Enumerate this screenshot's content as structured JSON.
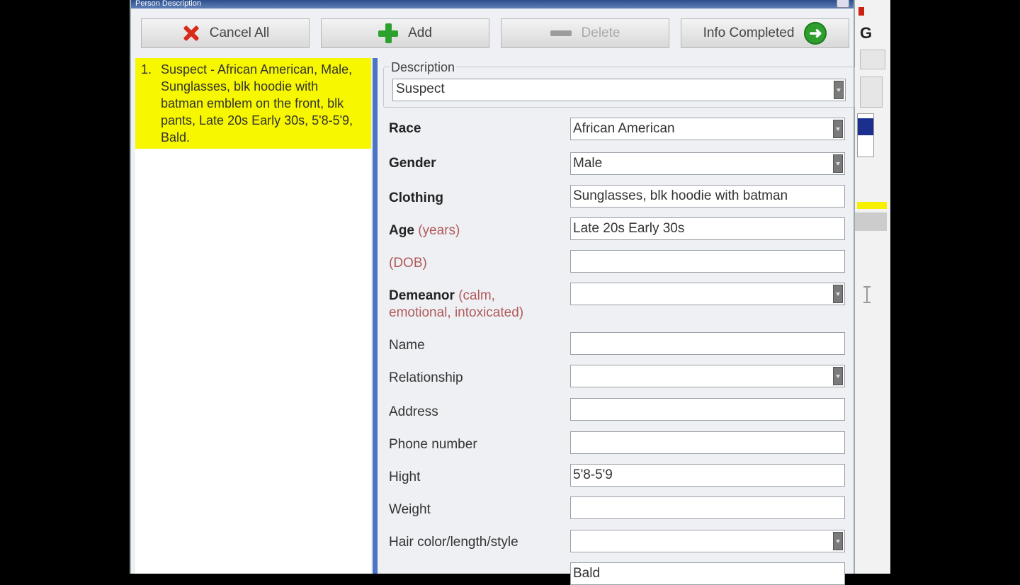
{
  "window": {
    "title": "Person Description"
  },
  "toolbar": {
    "cancel_label": "Cancel All",
    "add_label": "Add",
    "delete_label": "Delete",
    "complete_label": "Info Completed"
  },
  "list": {
    "items": [
      {
        "number": "1.",
        "text": "Suspect - African American, Male, Sunglasses, blk hoodie with batman emblem on the front, blk pants, Late 20s Early 30s, 5'8-5'9, Bald."
      }
    ]
  },
  "form": {
    "description_legend": "Description",
    "description_value": "Suspect",
    "race_label": "Race",
    "race_value": "African American",
    "gender_label": "Gender",
    "gender_value": "Male",
    "clothing_label": "Clothing",
    "clothing_value": "Sunglasses, blk hoodie with batman",
    "age_label": "Age",
    "age_hint": "(years)",
    "age_value": "Late 20s Early 30s",
    "dob_label": "(DOB)",
    "dob_value": "",
    "demeanor_label": "Demeanor",
    "demeanor_hint1": "(calm,",
    "demeanor_hint2": "emotional, intoxicated)",
    "demeanor_value": "",
    "name_label": "Name",
    "name_value": "",
    "relationship_label": "Relationship",
    "relationship_value": "",
    "address_label": "Address",
    "address_value": "",
    "phone_label": "Phone number",
    "phone_value": "",
    "height_label": "Hight",
    "height_value": "5'8-5'9",
    "weight_label": "Weight",
    "weight_value": "",
    "hair_label": "Hair color/length/style",
    "hair_value": "",
    "next_value": "Bald"
  },
  "background": {
    "app_letter": "G"
  },
  "colors": {
    "selection": "#f7f700",
    "separator": "#4a74c5",
    "cancel_icon": "#d9291b",
    "add_icon": "#2da12d"
  }
}
